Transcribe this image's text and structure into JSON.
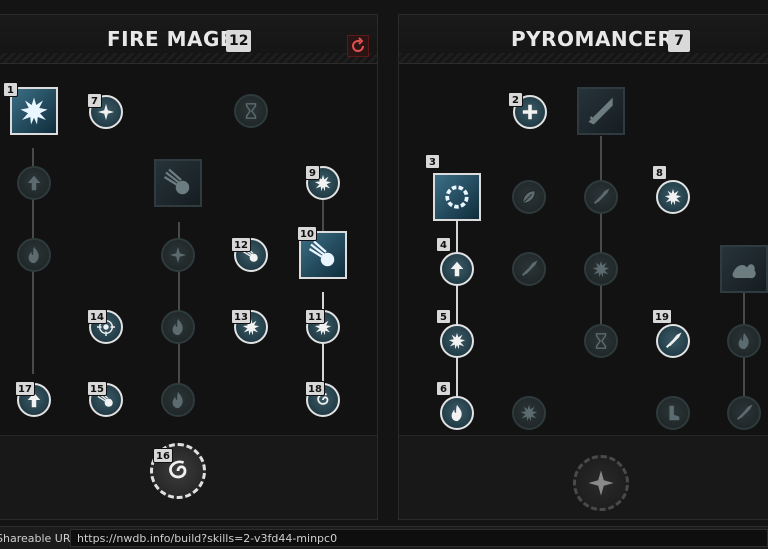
{
  "trees": [
    {
      "name": "FIRE MAGE",
      "points": "12"
    },
    {
      "name": "PYROMANCER",
      "points": "7"
    }
  ],
  "badges": [
    "1",
    "7",
    "9",
    "10",
    "12",
    "14",
    "13",
    "11",
    "17",
    "15",
    "18",
    "16",
    "2",
    "3",
    "8",
    "4",
    "5",
    "19",
    "6"
  ],
  "footer": {
    "label": "Shareable URL",
    "url": "https://nwdb.info/build?skills=2-v3fd44-minpc0"
  },
  "colors": {
    "background": "#121212",
    "node_active": "#17303a",
    "node_inactive": "#1c2325",
    "reset_accent": "#e05050"
  },
  "icons": {
    "reset": "refresh-icon",
    "nodes": [
      "flame-icon",
      "burst-icon",
      "fireball-icon",
      "meteor-icon",
      "crosshair-icon",
      "spiral-icon",
      "sword-icon",
      "arrow-up-icon",
      "hourglass-icon"
    ]
  }
}
